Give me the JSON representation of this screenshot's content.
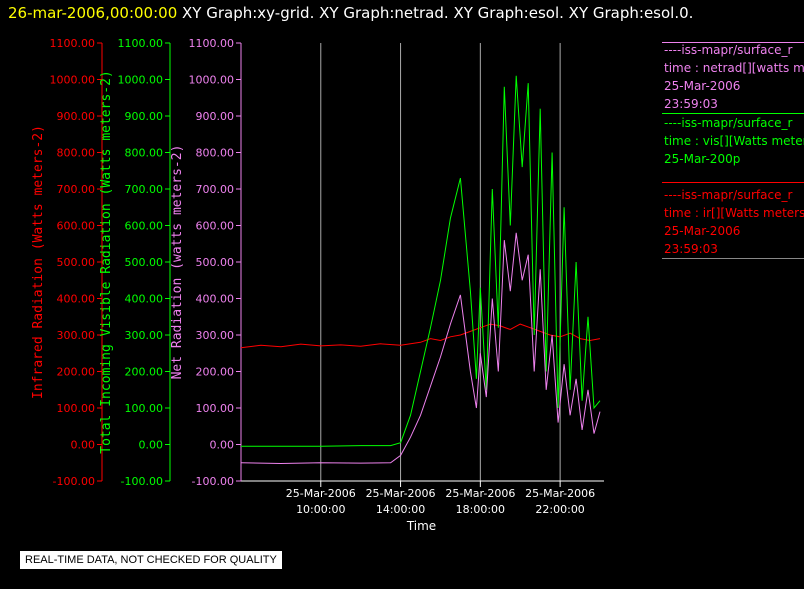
{
  "header": {
    "date": "26-mar-2006,00:00:00",
    "graphs": [
      "XY Graph:xy-grid.",
      "XY Graph:netrad.",
      "XY Graph:esol.",
      "XY Graph:esol.0."
    ]
  },
  "legend": [
    {
      "source": "----iss-mapr/surface_r",
      "desc": "time : netrad[][watts m",
      "date": "25-Mar-2006",
      "time": "23:59:03",
      "color": "#ee82ee"
    },
    {
      "source": "----iss-mapr/surface_r",
      "desc": "time : vis[][Watts meter",
      "date": "25-Mar-200p",
      "time": "",
      "color": "#00ff00"
    },
    {
      "source": "----iss-mapr/surface_r",
      "desc": "time : ir[][Watts meters",
      "date": "25-Mar-2006",
      "time": "23:59:03",
      "color": "#ff0000"
    }
  ],
  "disclaimer": "REAL-TIME DATA, NOT CHECKED FOR QUALITY",
  "colors": {
    "ir": "#ff0000",
    "vis": "#00ff00",
    "net": "#ee82ee",
    "grid": "#aaaaaa",
    "date": "#ffff00"
  },
  "chart_data": {
    "type": "line",
    "xlabel": "Time",
    "x_ticks": [
      "25-Mar-2006\n10:00:00",
      "25-Mar-2006\n14:00:00",
      "25-Mar-2006\n18:00:00",
      "25-Mar-2006\n22:00:00"
    ],
    "x_tick_hours": [
      10,
      14,
      18,
      22
    ],
    "xlim_hours": [
      6,
      24.2
    ],
    "ylim": [
      -100,
      1100
    ],
    "y_ticks": [
      -100,
      0,
      100,
      200,
      300,
      400,
      500,
      600,
      700,
      800,
      900,
      1000,
      1100
    ],
    "y_tick_labels": [
      "-100.00",
      "0.00",
      "100.00",
      "200.00",
      "300.00",
      "400.00",
      "500.00",
      "600.00",
      "700.00",
      "800.00",
      "900.00",
      "1000.00",
      "1100.00"
    ],
    "grid": "vertical lines at x ticks",
    "axes": [
      {
        "label": "Infrared Radiation (Watts meters-2)",
        "color": "#ff0000"
      },
      {
        "label": "Total Incoming Visible Radiation (Watts meters-2)",
        "color": "#00ff00"
      },
      {
        "label": "Net Radiation (watts meters-2)",
        "color": "#ee82ee"
      }
    ],
    "series": [
      {
        "name": "ir",
        "color": "#ff0000",
        "x": [
          6.0,
          7.0,
          8.0,
          9.0,
          10.0,
          11.0,
          12.0,
          13.0,
          14.0,
          15.0,
          15.5,
          16.0,
          16.5,
          17.0,
          17.5,
          18.0,
          18.5,
          19.0,
          19.5,
          20.0,
          20.5,
          21.0,
          21.5,
          22.0,
          22.5,
          23.0,
          23.5,
          24.0
        ],
        "y": [
          265,
          272,
          268,
          275,
          270,
          273,
          269,
          276,
          272,
          280,
          290,
          285,
          295,
          300,
          310,
          320,
          330,
          325,
          315,
          330,
          320,
          310,
          300,
          295,
          305,
          290,
          285,
          290
        ]
      },
      {
        "name": "vis",
        "color": "#00ff00",
        "x": [
          6.0,
          8.0,
          10.0,
          12.0,
          13.5,
          14.0,
          14.5,
          15.0,
          15.5,
          16.0,
          16.5,
          17.0,
          17.5,
          17.8,
          18.0,
          18.3,
          18.6,
          18.9,
          19.2,
          19.5,
          19.8,
          20.1,
          20.4,
          20.7,
          21.0,
          21.3,
          21.6,
          21.9,
          22.2,
          22.5,
          22.8,
          23.1,
          23.4,
          23.7,
          24.0
        ],
        "y": [
          -5,
          -5,
          -5,
          -3,
          -3,
          5,
          80,
          200,
          320,
          450,
          620,
          730,
          420,
          180,
          430,
          150,
          700,
          320,
          980,
          600,
          1010,
          760,
          990,
          300,
          920,
          200,
          800,
          100,
          650,
          150,
          500,
          120,
          350,
          100,
          120
        ]
      },
      {
        "name": "net",
        "color": "#ee82ee",
        "x": [
          6.0,
          8.0,
          10.0,
          12.0,
          13.5,
          14.0,
          14.5,
          15.0,
          15.5,
          16.0,
          16.5,
          17.0,
          17.5,
          17.8,
          18.0,
          18.3,
          18.6,
          18.9,
          19.2,
          19.5,
          19.8,
          20.1,
          20.4,
          20.7,
          21.0,
          21.3,
          21.6,
          21.9,
          22.2,
          22.5,
          22.8,
          23.1,
          23.4,
          23.7,
          24.0
        ],
        "y": [
          -50,
          -52,
          -50,
          -51,
          -50,
          -30,
          20,
          80,
          160,
          240,
          330,
          410,
          200,
          100,
          250,
          130,
          400,
          200,
          560,
          420,
          580,
          450,
          520,
          200,
          480,
          150,
          300,
          60,
          220,
          80,
          180,
          40,
          150,
          30,
          90
        ]
      }
    ]
  }
}
